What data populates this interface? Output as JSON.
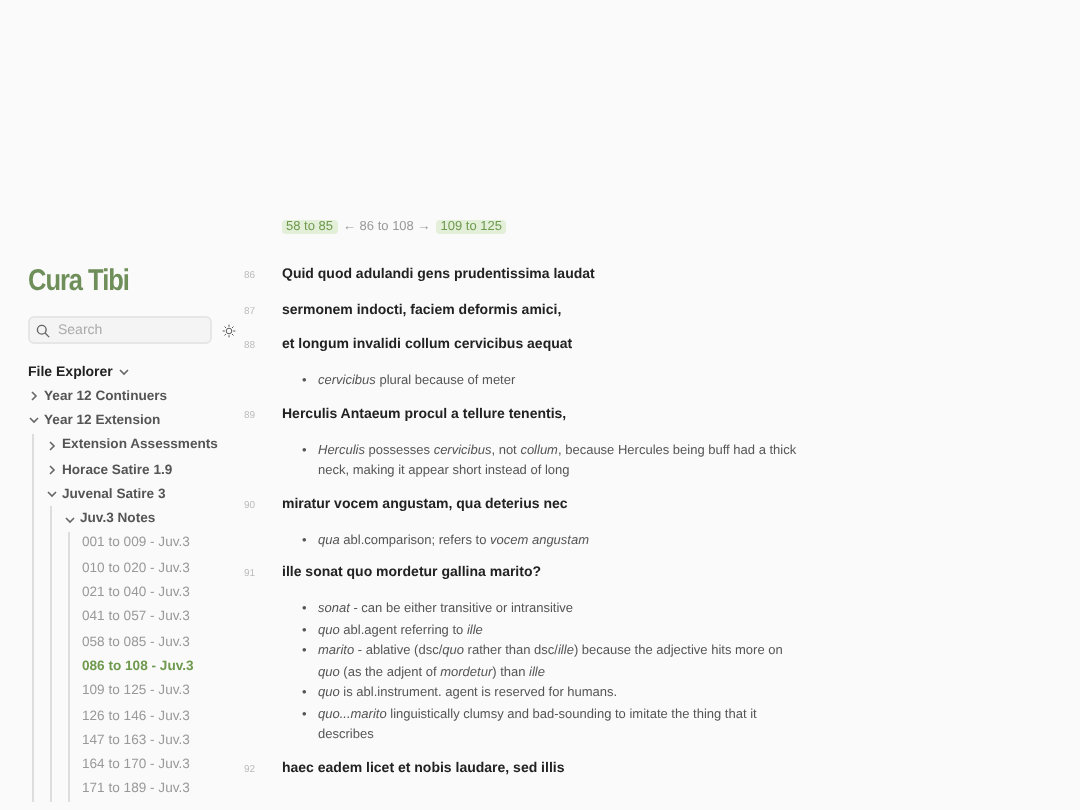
{
  "sidebar": {
    "title": "Cura Tibi",
    "search": {
      "placeholder": "Search"
    },
    "explorer_label": "File Explorer",
    "tree": [
      {
        "label": "Year 12 Continuers",
        "expanded": false
      },
      {
        "label": "Year 12 Extension",
        "expanded": true,
        "children": [
          {
            "label": "Extension Assessments",
            "expanded": false
          },
          {
            "label": "Horace Satire 1.9",
            "expanded": false
          },
          {
            "label": "Juvenal Satire 3",
            "expanded": true,
            "children": [
              {
                "label": "Juv.3 Notes",
                "expanded": true,
                "children": [
                  {
                    "label": "001 to 009 - Juv.3",
                    "selected": false
                  },
                  {
                    "label": "010 to 020 - Juv.3",
                    "selected": false
                  },
                  {
                    "label": "021 to 040 - Juv.3",
                    "selected": false
                  },
                  {
                    "label": "041 to 057 - Juv.3",
                    "selected": false
                  },
                  {
                    "label": "058 to 085 - Juv.3",
                    "selected": false
                  },
                  {
                    "label": "086 to 108 - Juv.3",
                    "selected": true
                  },
                  {
                    "label": "109 to 125 - Juv.3",
                    "selected": false
                  },
                  {
                    "label": "126 to 146 - Juv.3",
                    "selected": false
                  },
                  {
                    "label": "147 to 163 - Juv.3",
                    "selected": false
                  },
                  {
                    "label": "164 to 170 - Juv.3",
                    "selected": false
                  },
                  {
                    "label": "171 to 189 - Juv.3",
                    "selected": false
                  }
                ]
              }
            ]
          }
        ]
      }
    ]
  },
  "bullet": "•",
  "nav": {
    "previous": "58 to 85",
    "current": "← 86 to 108 →",
    "next": "109 to 125"
  },
  "verses": [
    {
      "number": "86",
      "text": "Quid quod adulandi gens prudentissima laudat"
    },
    {
      "number": "87",
      "text": "sermonem indocti, faciem deformis amici,"
    },
    {
      "number": "88",
      "text": "et longum invalidi collum cervicibus aequat",
      "notes": [
        "*cervicibus* plural because of meter"
      ]
    },
    {
      "number": "89",
      "text": "Herculis Antaeum procul a tellure tenentis,",
      "notes": [
        "*Herculis* possesses *cervicibus*, not *collum*, because Hercules being buff had a thick neck, making it appear short instead of long"
      ]
    },
    {
      "number": "90",
      "text": "miratur vocem angustam, qua deterius nec",
      "notes": [
        "*qua* abl.comparison; refers to *vocem angustam*"
      ]
    },
    {
      "number": "91",
      "text": "ille sonat quo mordetur gallina marito?",
      "notes": [
        "*sonat* - can be either transitive or intransitive",
        "*quo* abl.agent referring to *ille*",
        "*marito* - ablative (dsc/*quo* rather than dsc/*ille*) because the adjective hits more on *quo* (as the adjent of *mordetur*) than *ille*",
        "*quo* is abl.instrument. agent is reserved for humans.",
        "*quo...marito* linguistically clumsy and bad-sounding to imitate the thing that it describes"
      ]
    },
    {
      "number": "92",
      "text": "haec eadem licet et nobis laudare, sed illis"
    }
  ]
}
